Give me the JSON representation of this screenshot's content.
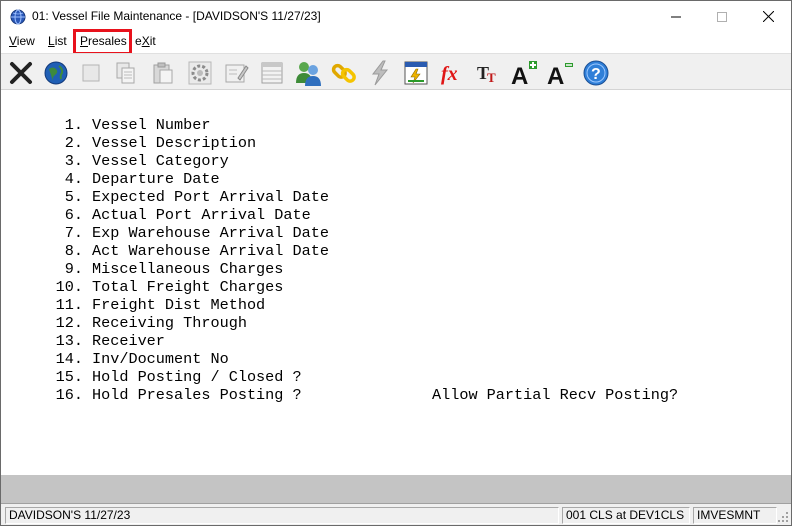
{
  "window": {
    "title": "01: Vessel File Maintenance - [DAVIDSON'S 11/27/23]"
  },
  "menu": {
    "items": [
      {
        "label": "View",
        "mnemonic": "V",
        "rest": "iew"
      },
      {
        "label": "List",
        "mnemonic": "L",
        "rest": "ist"
      },
      {
        "label": "Presales",
        "mnemonic": "P",
        "rest": "resales",
        "highlighted": true
      },
      {
        "label": "eXit",
        "pre": "e",
        "mnemonic": "X",
        "rest": "it"
      }
    ]
  },
  "toolbar": {
    "buttons": [
      "close-x-icon",
      "globe-icon",
      "blank-icon",
      "copy-icon",
      "paste-icon",
      "settings-gear-icon",
      "edit-form-icon",
      "grid-icon",
      "users-icon",
      "link-icon",
      "lightning-icon",
      "calculator-icon",
      "function-icon",
      "font-size-icon",
      "font-increase-icon",
      "font-decrease-icon",
      "help-icon"
    ],
    "colors": {
      "accent": "#e8121c",
      "help": "#2f7fd8",
      "globe": "#1f5fb5"
    }
  },
  "fields": [
    {
      "num": "1.",
      "label": "Vessel Number"
    },
    {
      "num": "2.",
      "label": "Vessel Description"
    },
    {
      "num": "3.",
      "label": "Vessel Category"
    },
    {
      "num": "4.",
      "label": "Departure Date"
    },
    {
      "num": "5.",
      "label": "Expected Port Arrival Date"
    },
    {
      "num": "6.",
      "label": "Actual Port Arrival Date"
    },
    {
      "num": "7.",
      "label": "Exp Warehouse Arrival Date"
    },
    {
      "num": "8.",
      "label": "Act Warehouse Arrival Date"
    },
    {
      "num": "9.",
      "label": "Miscellaneous Charges"
    },
    {
      "num": "10.",
      "label": "Total Freight Charges"
    },
    {
      "num": "11.",
      "label": "Freight Dist Method"
    },
    {
      "num": "12.",
      "label": "Receiving Through"
    },
    {
      "num": "13.",
      "label": "Receiver"
    },
    {
      "num": "14.",
      "label": "Inv/Document No"
    },
    {
      "num": "15.",
      "label": "Hold Posting / Closed ?"
    },
    {
      "num": "16.",
      "label": "Hold Presales Posting ?"
    }
  ],
  "extra_label": "Allow Partial Recv Posting?",
  "status": {
    "company": "DAVIDSON'S 11/27/23",
    "session": "001 CLS at DEV1CLS",
    "program": "IMVESMNT"
  }
}
